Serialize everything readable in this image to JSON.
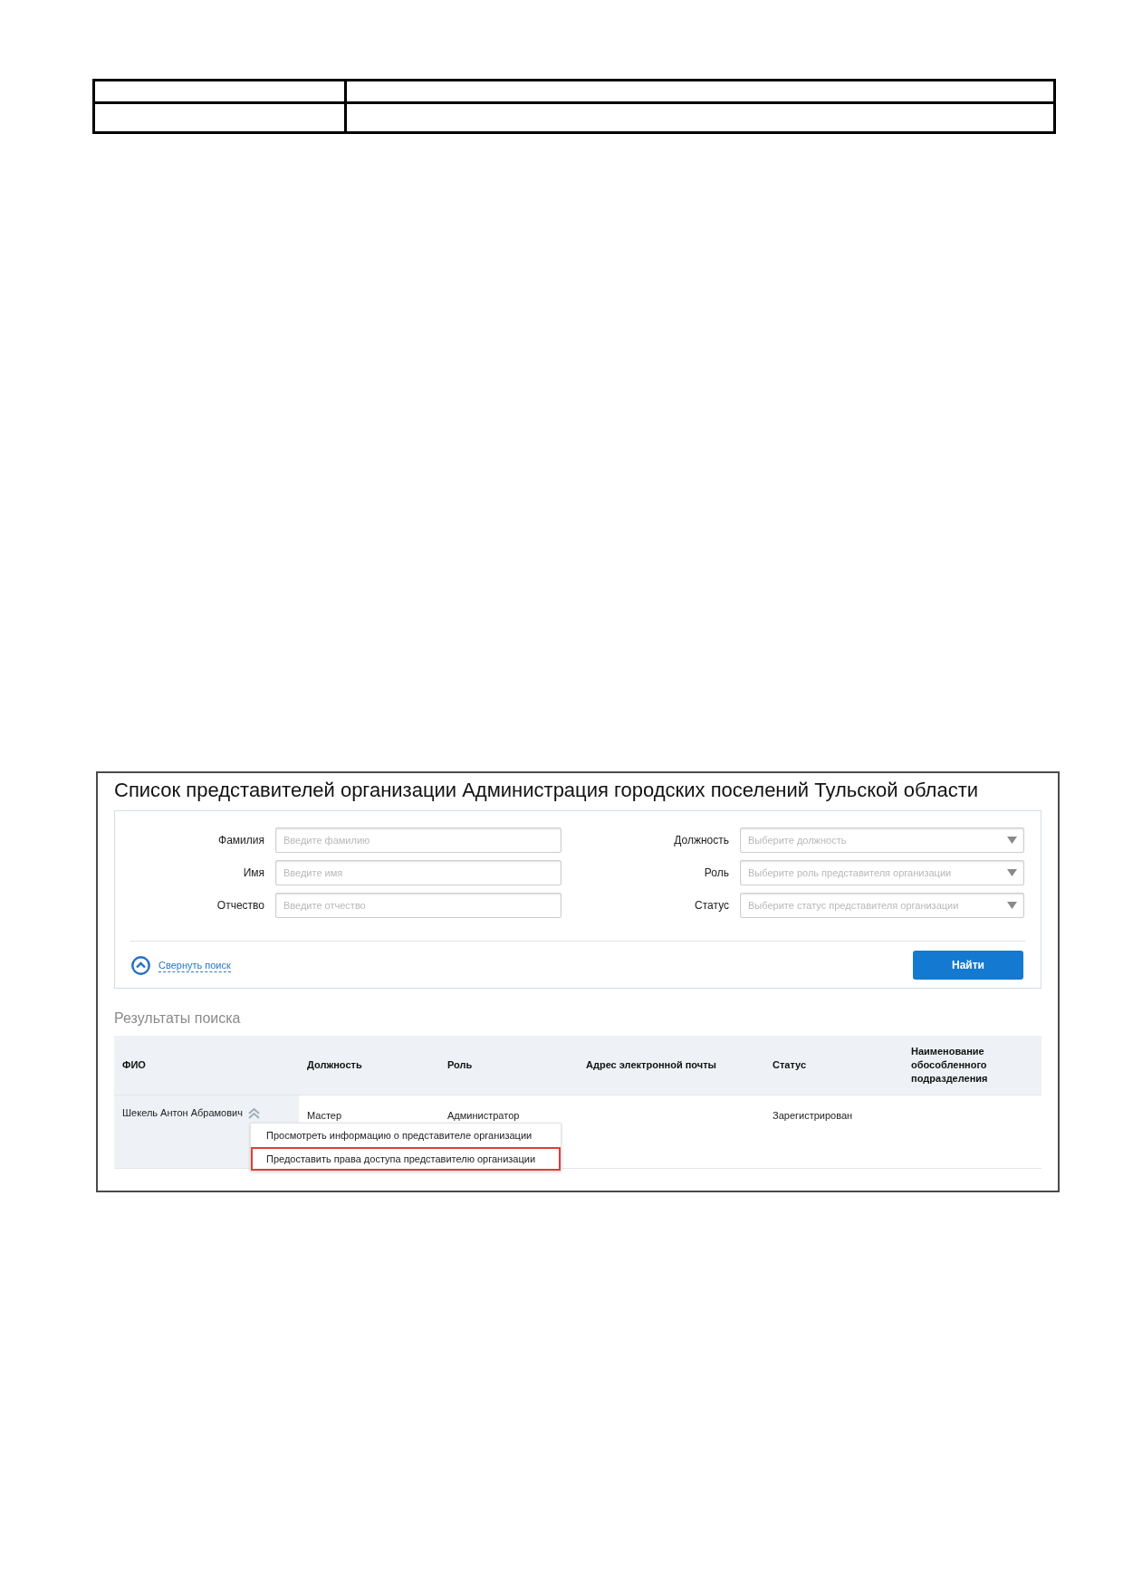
{
  "page": {
    "title": "Список представителей организации Администрация городских поселений Тульской области"
  },
  "search_form": {
    "left_fields": [
      {
        "kind": "text",
        "label": "Фамилия",
        "placeholder": "Введите фамилию"
      },
      {
        "kind": "text",
        "label": "Имя",
        "placeholder": "Введите имя"
      },
      {
        "kind": "text",
        "label": "Отчество",
        "placeholder": "Введите отчество"
      }
    ],
    "right_fields": [
      {
        "kind": "select",
        "label": "Должность",
        "placeholder": "Выберите должность"
      },
      {
        "kind": "select",
        "label": "Роль",
        "placeholder": "Выберите роль представителя организации"
      },
      {
        "kind": "select",
        "label": "Статус",
        "placeholder": "Выберите статус представителя организации"
      }
    ],
    "collapse_link": "Свернуть поиск",
    "search_button": "Найти"
  },
  "results": {
    "heading": "Результаты поиска",
    "columns": [
      "ФИО",
      "Должность",
      "Роль",
      "Адрес электронной почты",
      "Статус",
      "Наименование обособленного подразделения"
    ],
    "rows": [
      {
        "full_name": "Шекель Антон Абрамович",
        "position": "Мастер",
        "role": "Администратор",
        "status": "Зарегистрирован",
        "menu_open": true,
        "menu": [
          {
            "label": "Просмотреть информацию о представителе организации",
            "highlighted": false
          },
          {
            "label": "Предоставить права доступа представителю организации",
            "highlighted": true
          }
        ]
      }
    ]
  }
}
